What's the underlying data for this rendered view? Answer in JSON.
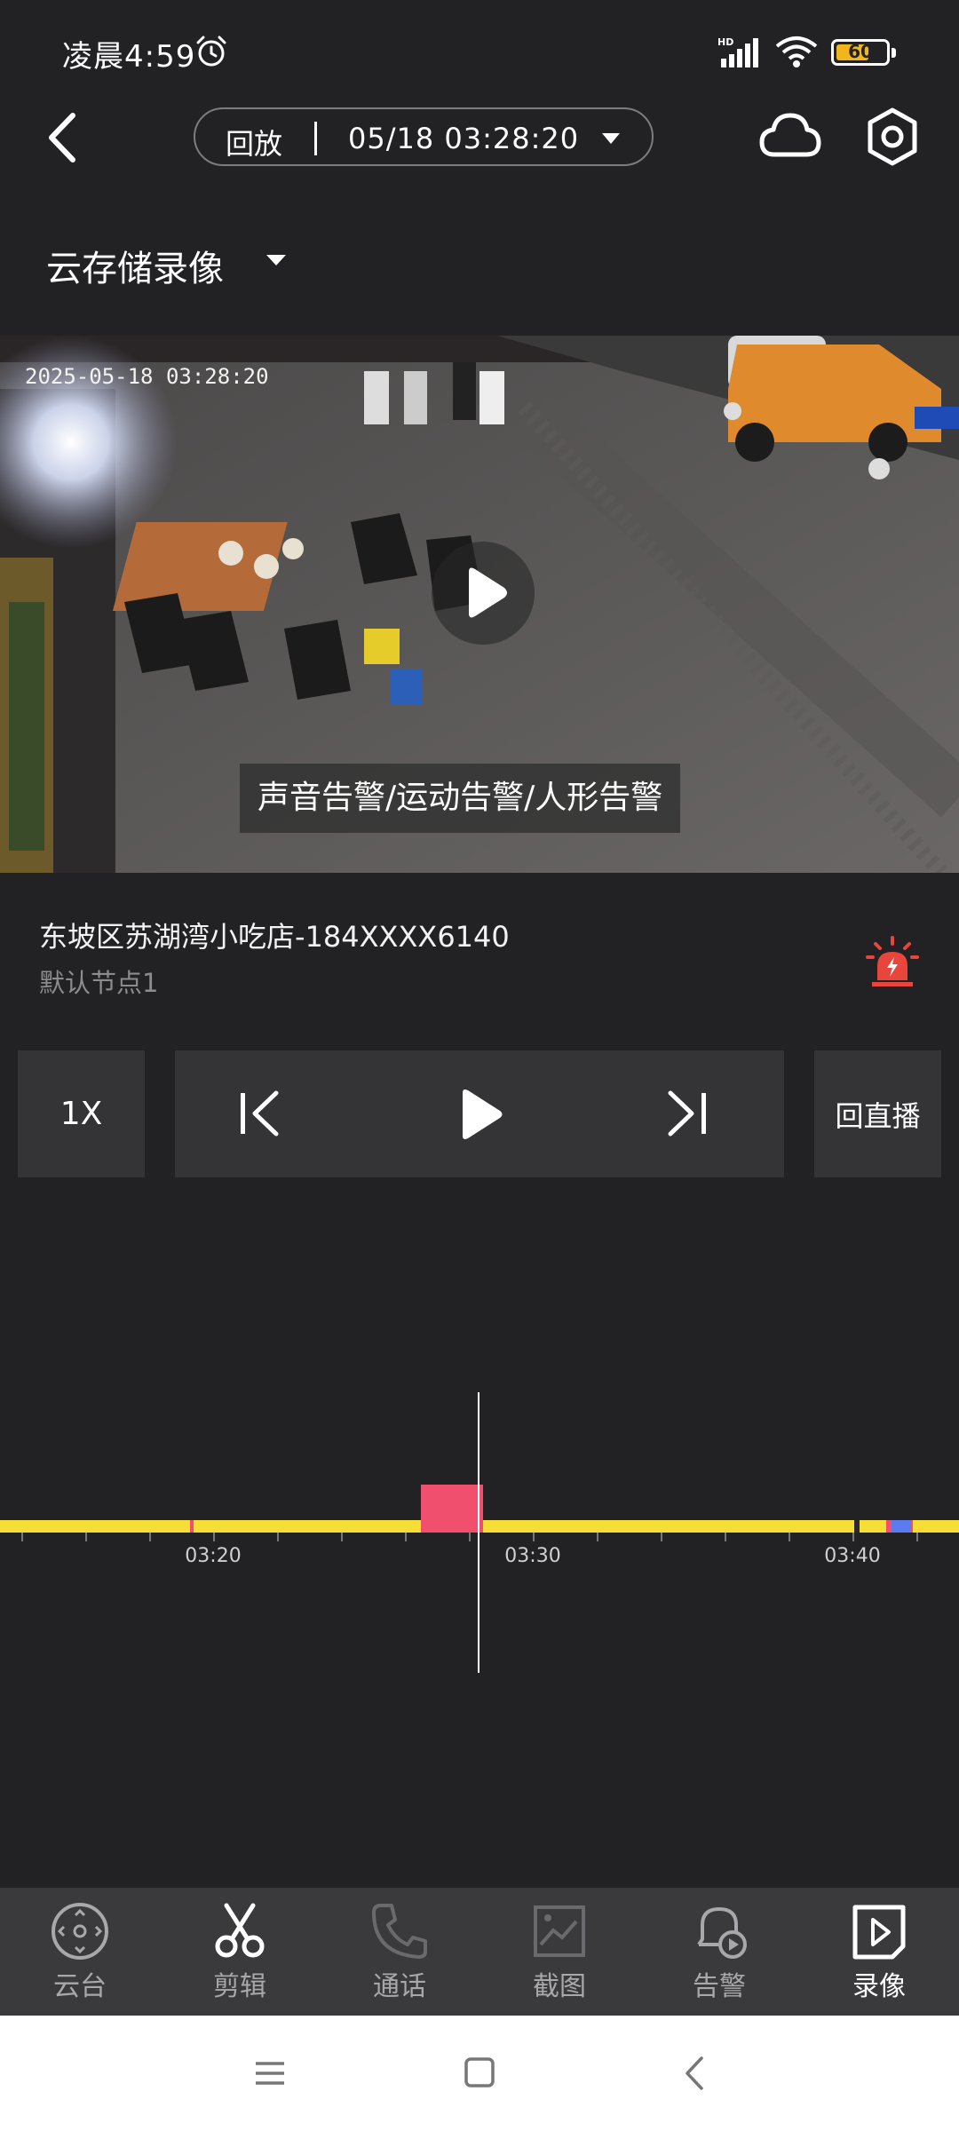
{
  "status_bar": {
    "time": "凌晨4:59",
    "network": "HD",
    "battery": "60"
  },
  "header": {
    "mode": "回放",
    "datetime": "05/18 03:28:20"
  },
  "source": {
    "label": "云存储录像"
  },
  "video": {
    "timestamp": "2025-05-18 03:28:20",
    "caption": "声音告警/运动告警/人形告警"
  },
  "device": {
    "name": "东坡区苏湖湾小吃店-184XXXX6140",
    "node": "默认节点1"
  },
  "controls": {
    "speed": "1X",
    "live": "回直播"
  },
  "timeline": {
    "labels": [
      "03:20",
      "03:30",
      "03:40"
    ],
    "current_time": "03:28:20",
    "colors": {
      "recording": "#f7de36",
      "event": "#f0506e",
      "motion": "#5b7cf0"
    }
  },
  "toolbar": {
    "items": [
      {
        "label": "云台",
        "icon": "ptz-icon"
      },
      {
        "label": "剪辑",
        "icon": "scissors-icon"
      },
      {
        "label": "通话",
        "icon": "phone-icon"
      },
      {
        "label": "截图",
        "icon": "screenshot-icon"
      },
      {
        "label": "告警",
        "icon": "alarm-bell-icon"
      },
      {
        "label": "录像",
        "icon": "video-record-icon"
      }
    ],
    "active": "录像"
  },
  "colors": {
    "background": "#222124",
    "panel": "#343437",
    "accent_red": "#e8453c"
  }
}
